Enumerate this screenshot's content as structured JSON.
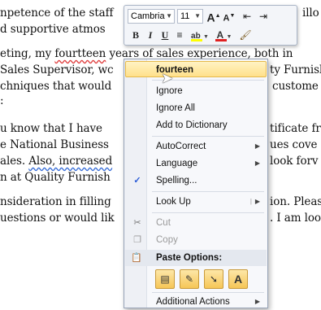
{
  "document": {
    "lines": [
      "npetence of the staff",
      "d supportive atmos",
      "",
      "eting, my fourtteen years of sales experience, both in",
      "Sales Supervisor, wc",
      "chniques that would",
      ":",
      "",
      "u know that I have",
      "e National Business",
      "ales. Also, increased",
      "n at Quality Furnish",
      "",
      "nsideration in filling",
      "uestions or would lik"
    ],
    "right_lines": [
      "illo",
      "",
      "",
      "",
      "ty Furnish",
      "custome",
      "",
      "",
      "tificate fr",
      "ues cove",
      "look forv",
      "",
      "",
      "ion. Pleas",
      ". I am loo"
    ]
  },
  "mini_toolbar": {
    "font_name": "Cambria",
    "font_size": "11",
    "grow_font": "A",
    "shrink_font": "A",
    "bold": "B",
    "italic": "I",
    "underline": "U",
    "font_color_letter": "A",
    "highlight_color": "#ffff00",
    "font_color": "#e02020"
  },
  "context_menu": {
    "suggestion": "fourteen",
    "items": [
      {
        "label": "Ignore"
      },
      {
        "label": "Ignore All"
      },
      {
        "label": "Add to Dictionary"
      },
      {
        "label": "AutoCorrect"
      },
      {
        "label": "Language"
      },
      {
        "label": "Spelling..."
      },
      {
        "label": "Look Up"
      },
      {
        "label": "Cut"
      },
      {
        "label": "Copy"
      },
      {
        "label": "Paste Options:"
      },
      {
        "label": "Additional Actions"
      }
    ]
  }
}
